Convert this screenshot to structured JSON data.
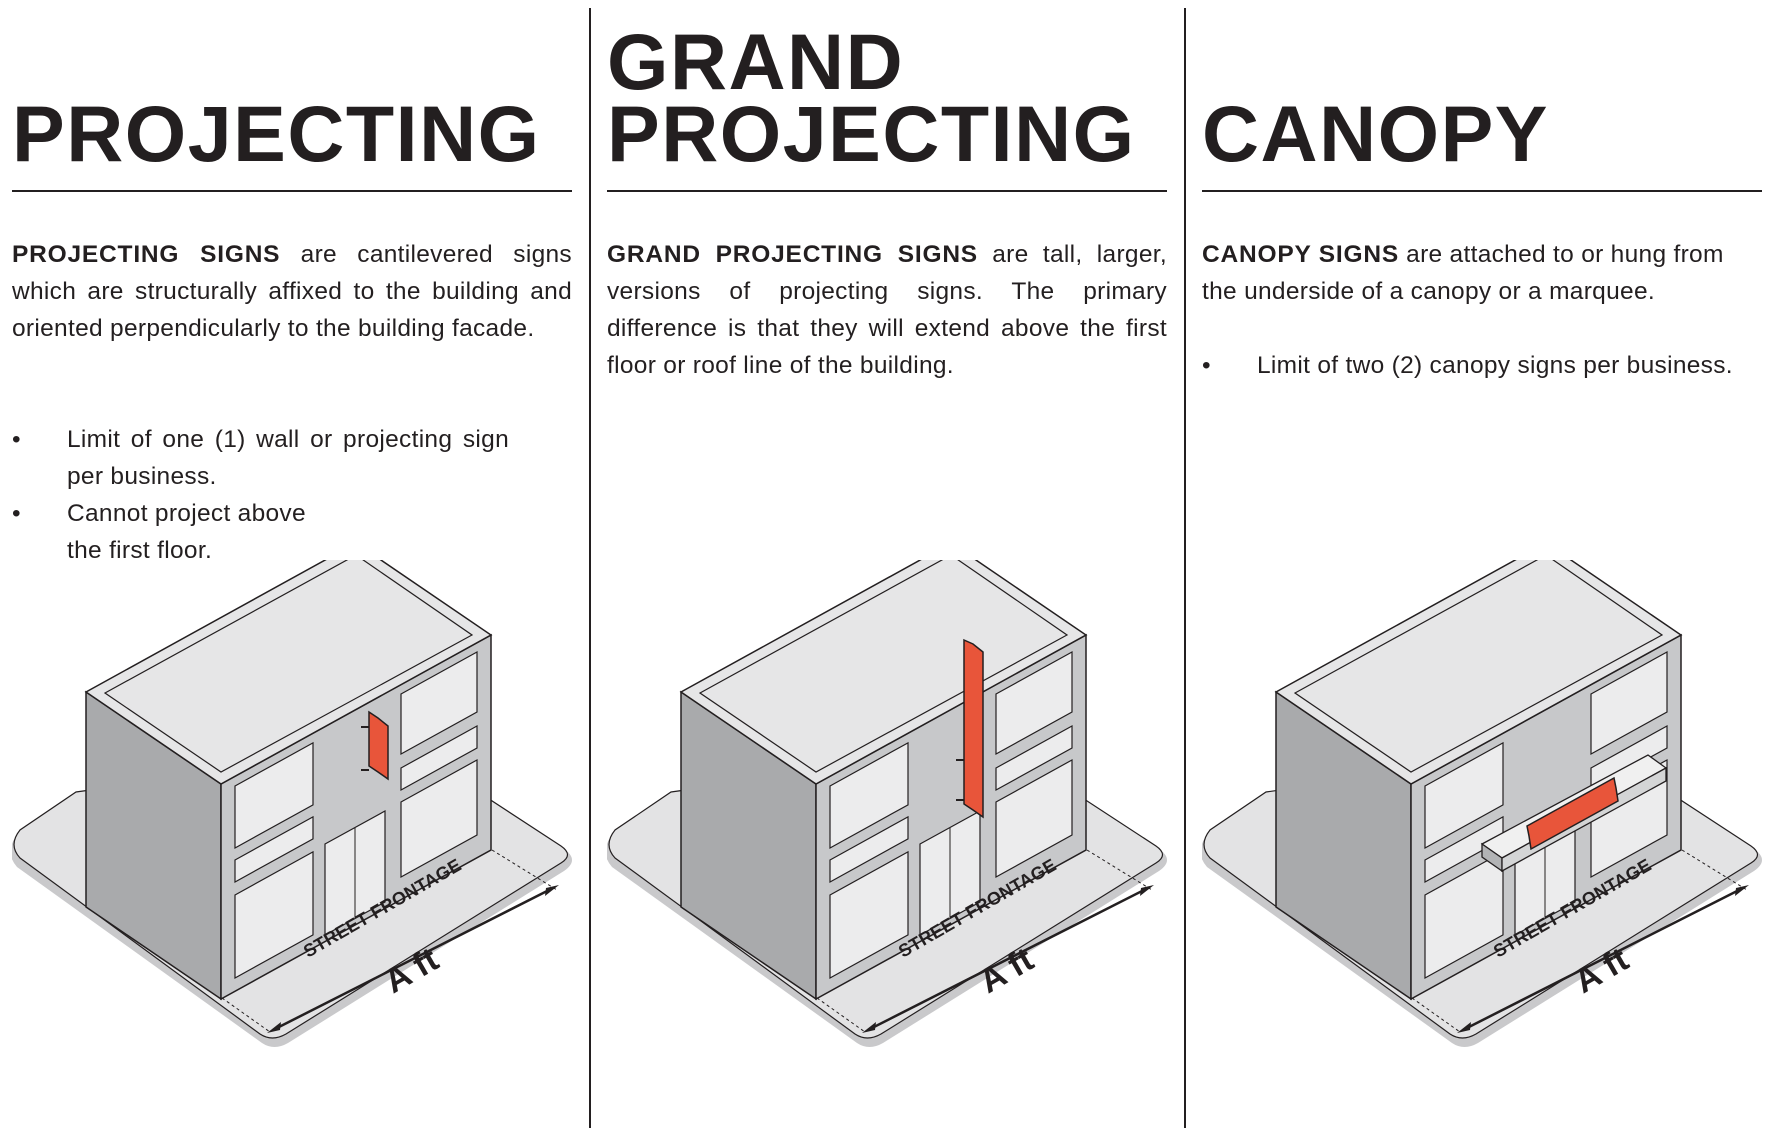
{
  "colors": {
    "text": "#231f20",
    "sign": "#e8553a",
    "roof": "#e6e6e7",
    "front_wall": "#a9aaac",
    "side_wall": "#c7c8ca",
    "window": "#ececed",
    "ground": "#e3e3e4"
  },
  "panels": [
    {
      "title_lines": [
        "",
        "PROJECTING"
      ],
      "desc_bold": "PROJECTING SIGNS",
      "desc_rest": " are cantilevered signs which are structurally affixed to the building and oriented perpendicularly to the building facade.",
      "bullets": [
        "Limit of one (1) wall or projecting sign per business.",
        "Cannot project above the first floor."
      ],
      "street_label": "STREET FRONTAGE",
      "dimension_label": "A ft"
    },
    {
      "title_lines": [
        "GRAND",
        "PROJECTING"
      ],
      "desc_bold": "GRAND PROJECTING SIGNS",
      "desc_rest": " are tall, larger, versions of projecting signs. The primary difference is that they will extend above the first floor or roof line of the building.",
      "bullets": [],
      "street_label": "STREET FRONTAGE",
      "dimension_label": "A ft"
    },
    {
      "title_lines": [
        "",
        "CANOPY"
      ],
      "desc_bold": "CANOPY SIGNS",
      "desc_rest": " are attached to or hung from the underside of a canopy or a marquee.",
      "bullets": [
        "Limit of two (2) canopy signs per business."
      ],
      "street_label": "STREET FRONTAGE",
      "dimension_label": "A ft"
    }
  ],
  "bullet_char": "•"
}
